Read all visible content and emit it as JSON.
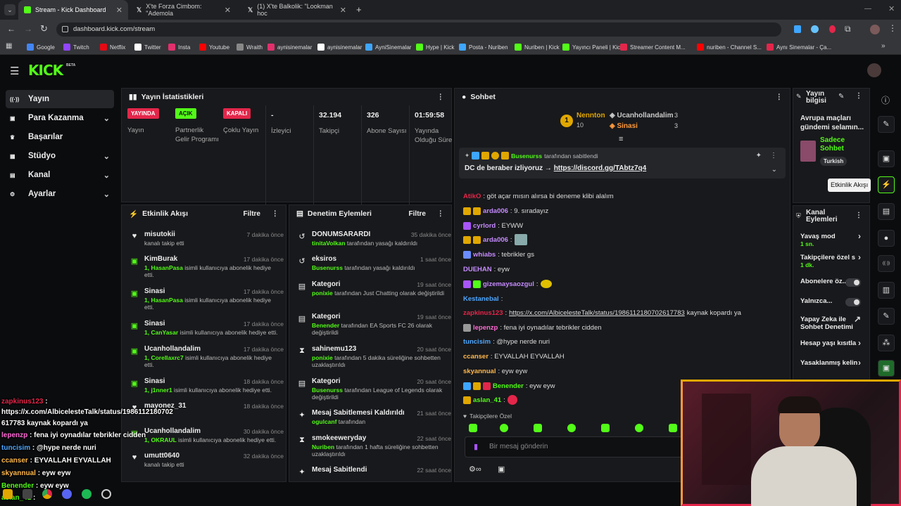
{
  "browser": {
    "tabs": [
      {
        "label": "Stream - Kick Dashboard",
        "icon": "kick-favicon"
      },
      {
        "label": "X'te Forza Cimbom: \"Ademola",
        "icon": "x-favicon"
      },
      {
        "label": "(1) X'te Balkolik: \"Lookman hoc",
        "icon": "x-favicon"
      }
    ],
    "new_tab": "+",
    "url": "dashboard.kick.com/stream",
    "bookmarks": [
      "Google",
      "Twitch",
      "Netflix",
      "Twitter",
      "Insta",
      "Youtube",
      "Wraith",
      "aynisinemalar",
      "aynisinemalar",
      "AyniSinemalar",
      "Hype | Kick",
      "Posta - Nuriben",
      "Nuriben | Kick",
      "Yayıncı Paneli | Kick",
      "Streamer Content M...",
      "nuriben - Channel S...",
      "Aynı Sinemalar - Ça..."
    ],
    "more": "»"
  },
  "header": {
    "logo": "KICK",
    "beta": "BETA"
  },
  "sidebar": {
    "items": [
      {
        "label": "Yayın",
        "icon": "broadcast-icon",
        "chev": ""
      },
      {
        "label": "Para Kazanma",
        "icon": "wallet-icon",
        "chev": "⌄"
      },
      {
        "label": "Başarılar",
        "icon": "trophy-icon",
        "chev": ""
      },
      {
        "label": "Stüdyo",
        "icon": "studio-icon",
        "chev": "⌄"
      },
      {
        "label": "Kanal",
        "icon": "channel-icon",
        "chev": "⌄"
      },
      {
        "label": "Ayarlar",
        "icon": "gear-icon",
        "chev": "⌄"
      }
    ]
  },
  "stats": {
    "title": "Yayın İstatistikleri",
    "items": [
      {
        "badge": "YAYINDA",
        "badge_color": "#e3264a",
        "label": "Yayın"
      },
      {
        "badge": "AÇIK",
        "badge_color": "#53fc18",
        "label": "Partnerlik Gelir Programı"
      },
      {
        "badge": "KAPALI",
        "badge_color": "#e3264a",
        "label": "Çoklu Yayın"
      },
      {
        "value": "-",
        "label": "İzleyici"
      },
      {
        "value": "32.194",
        "label": "Takipçi"
      },
      {
        "value": "326",
        "label": "Abone Sayısı"
      },
      {
        "value": "01:59:58",
        "label": "Yayında Olduğu Süre"
      }
    ]
  },
  "activity": {
    "title": "Etkinlik Akışı",
    "filter": "Filtre",
    "events": [
      {
        "name": "misutokii",
        "time": "7 dakika önce",
        "desc": "kanalı takip etti",
        "icon": "heart-icon"
      },
      {
        "name": "KimBurak",
        "time": "17 dakika önce",
        "hl": "1, HasanPasa",
        "desc": " isimli kullanıcıya abonelik hediye etti.",
        "icon": "gift-icon"
      },
      {
        "name": "Sinasi",
        "time": "17 dakika önce",
        "hl": "1, HasanPasa",
        "desc": " isimli kullanıcıya abonelik hediye etti.",
        "icon": "gift-icon"
      },
      {
        "name": "Sinasi",
        "time": "17 dakika önce",
        "hl": "1, CanYasar",
        "desc": " isimli kullanıcıya abonelik hediye etti.",
        "icon": "gift-icon"
      },
      {
        "name": "Ucanhollandalim",
        "time": "17 dakika önce",
        "hl": "1, Corellaxrc7",
        "desc": " isimli kullanıcıya abonelik hediye etti.",
        "icon": "gift-icon"
      },
      {
        "name": "Sinasi",
        "time": "18 dakika önce",
        "hl": "1, j1nner1",
        "desc": " isimli kullanıcıya abonelik hediye etti.",
        "icon": "gift-icon"
      },
      {
        "name": "mayonez_31",
        "time": "18 dakika önce",
        "desc": "",
        "icon": "heart-icon"
      },
      {
        "name": "Ucanhollandalim",
        "time": "30 dakika önce",
        "hl": "1, OKRAUL",
        "desc": " isimli kullanıcıya abonelik hediye etti.",
        "icon": "gift-icon"
      },
      {
        "name": "umutt0640",
        "time": "32 dakika önce",
        "desc": "kanalı takip etti",
        "icon": "heart-icon"
      }
    ]
  },
  "moderation": {
    "title": "Denetim Eylemleri",
    "filter": "Filtre",
    "events": [
      {
        "name": "DONUMSARARDI",
        "time": "35 dakika önce",
        "hl": "tinitaVolkan",
        "desc": " tarafından yasağı kaldırıldı",
        "icon": "undo-icon"
      },
      {
        "name": "eksiros",
        "time": "1 saat önce",
        "hl": "Busenurss",
        "desc": " tarafından yasağı kaldırıldı",
        "icon": "undo-icon"
      },
      {
        "name": "Kategori",
        "time": "19 saat önce",
        "hl": "ponixie",
        "desc": " tarafından Just Chatting olarak değiştirildi",
        "icon": "category-icon"
      },
      {
        "name": "Kategori",
        "time": "19 saat önce",
        "hl": "Benender",
        "desc": " tarafından EA Sports FC 26 olarak değiştirildi",
        "icon": "category-icon"
      },
      {
        "name": "sahinemu123",
        "time": "20 saat önce",
        "hl": "ponixie",
        "desc": " tarafından 5 dakika süreliğine sohbetten uzaklaştırıldı",
        "icon": "hourglass-icon"
      },
      {
        "name": "Kategori",
        "time": "20 saat önce",
        "hl": "Busenurss",
        "desc": " tarafından League of Legends olarak değiştirildi",
        "icon": "category-icon"
      },
      {
        "name": "Mesaj Sabitlemesi Kaldırıldı",
        "time": "21 saat önce",
        "hl": "ogulcanf",
        "desc": " tarafından",
        "icon": "unpin-icon"
      },
      {
        "name": "smokeeweryday",
        "time": "22 saat önce",
        "hl": "Nuriben",
        "desc": " tarafından 1 hafta süreliğine sohbetten uzaklaştırıldı",
        "icon": "hourglass-icon"
      },
      {
        "name": "Mesaj Sabitlendi",
        "time": "22 saat önce",
        "desc": "",
        "icon": "pin-icon"
      }
    ]
  },
  "chat": {
    "title": "Sohbet",
    "leaderboard": [
      {
        "rank": "1",
        "name": "Nennton",
        "count": "10"
      },
      {
        "name": "Ucanhollandalim",
        "count": "3"
      },
      {
        "name": "Sinasi",
        "count": "3"
      }
    ],
    "pinned": {
      "by": "Busenurss",
      "by_suffix": " tarafından sabitlendi",
      "text": "DC de beraber izliyoruz → ",
      "link": "https://discord.gg/TAbtz7q4"
    },
    "messages": [
      {
        "user": "AtikO",
        "color": "#e3264a",
        "text": ": göt açar mısın alırsa bi deneme klibi alalım",
        "badges": []
      },
      {
        "user": "arda006",
        "color": "#c58bff",
        "text": ": 9. sıradayız",
        "badges": [
          "#e0a700",
          "#e0a700"
        ]
      },
      {
        "user": "cyrlord",
        "color": "#c58bff",
        "text": ": EYWW",
        "badges": [
          "#a855f7"
        ]
      },
      {
        "user": "arda006",
        "color": "#c58bff",
        "text": ":",
        "badges": [
          "#e0a700",
          "#e0a700"
        ]
      },
      {
        "user": "whiabs",
        "color": "#c58bff",
        "text": ": tebrikler gs",
        "badges": [
          "#6b8cff"
        ]
      },
      {
        "user": "DUEHAN",
        "color": "#c58bff",
        "text": ": eyw",
        "badges": []
      },
      {
        "user": "gizemaysaozgul",
        "color": "#c58bff",
        "text": ":",
        "badges": [
          "#a855f7",
          "#53fc18"
        ]
      },
      {
        "user": "Kestanebal",
        "color": "#4da6ff",
        "text": ":",
        "badges": []
      },
      {
        "user": "zapkinus123",
        "color": "#e3264a",
        "text": ":",
        "link": "https://x.com/AlbicelesteTalk/status/1986112180702617783",
        "tail": " kaynak kopardı ya",
        "badges": []
      },
      {
        "user": "lepenzp",
        "color": "#ff6ad5",
        "text": ": fena iyi oynadılar tebrikler cidden",
        "badges": [
          "#999"
        ]
      },
      {
        "user": "tuncisim",
        "color": "#4da6ff",
        "text": ": @hype nerde nuri",
        "badges": []
      },
      {
        "user": "ccanser",
        "color": "#ffb84d",
        "text": ": EYVALLAH EYVALLAH",
        "badges": []
      },
      {
        "user": "skyannual",
        "color": "#ffb84d",
        "text": ": eyw eyw",
        "badges": []
      },
      {
        "user": "Benender",
        "color": "#53fc18",
        "text": ": eyw eyw",
        "badges": [
          "#3ea6ff",
          "#e0a700",
          "#e3264a"
        ]
      },
      {
        "user": "aslan_41",
        "color": "#53fc18",
        "text": ":",
        "badges": [
          "#e0a700"
        ]
      }
    ],
    "followers_only": "Takipçilere Özel",
    "placeholder": "Bir mesaj gönderin"
  },
  "stream_info": {
    "title": "Yayın bilgisi",
    "desc": "Avrupa maçları gündemi selamın...",
    "mode": "Sadece Sohbet",
    "lang": "Turkish"
  },
  "tooltip": "Etkinlik Akışı",
  "channel_actions": {
    "title": "Kanal Eylemleri",
    "items": [
      {
        "label": "Yavaş mod",
        "sub": "1 sn.",
        "ctrl": "chev"
      },
      {
        "label": "Takipçilere özel s",
        "sub": "1 dk.",
        "ctrl": "chev"
      },
      {
        "label": "Abonelere öz...",
        "ctrl": "toggle"
      },
      {
        "label": "Yalnızca...",
        "ctrl": "toggle"
      },
      {
        "label": "Yapay Zeka ile Sohbet Denetimi",
        "ctrl": "ext"
      },
      {
        "label": "Hesap yaşı kısıtla",
        "ctrl": "chev"
      },
      {
        "label": "Yasaklanmış kelin",
        "ctrl": "chev"
      }
    ]
  },
  "overlay": [
    {
      "user": "zapkinus123",
      "color": "#e3264a",
      "text": " :"
    },
    {
      "user": "",
      "color": "#fff",
      "text": "https://x.com/AlbicelesteTalk/status/1986112180702"
    },
    {
      "user": "",
      "color": "#fff",
      "text": "617783 kaynak kopardı ya"
    },
    {
      "user": "lepenzp",
      "color": "#ff6ad5",
      "text": " : fena iyi oynadılar tebrikler cidden"
    },
    {
      "user": "tuncisim",
      "color": "#4da6ff",
      "text": " : @hype nerde nuri"
    },
    {
      "user": "ccanser",
      "color": "#ffb84d",
      "text": " : EYVALLAH EYVALLAH"
    },
    {
      "user": "skyannual",
      "color": "#ffb84d",
      "text": " : eyw eyw"
    },
    {
      "user": "Benender",
      "color": "#53fc18",
      "text": " : eyw eyw"
    },
    {
      "user": "aslan_41",
      "color": "#53fc18",
      "text": " :"
    }
  ]
}
